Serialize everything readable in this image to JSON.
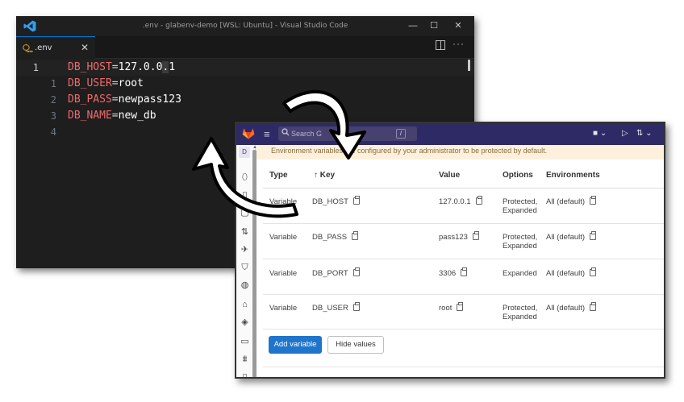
{
  "vscode": {
    "title": ".env - glabenv-demo [WSL: Ubuntu] - Visual Studio Code",
    "window_buttons": [
      "—",
      "☐",
      "✕"
    ],
    "tab": {
      "icon": "⵿",
      "label": ".env",
      "close": "✕"
    },
    "more": "···",
    "lines": [
      {
        "number": "1",
        "key": "DB_HOST",
        "eq": "=",
        "value_a": "127.0.0",
        "value_sel": ".",
        "value_b": "1"
      },
      {
        "number": "1",
        "key": "DB_USER",
        "eq": "=",
        "value": "root"
      },
      {
        "number": "2",
        "key": "DB_PASS",
        "eq": "=",
        "value": "newpass123"
      },
      {
        "number": "3",
        "key": "DB_NAME",
        "eq": "=",
        "value": "new_db"
      },
      {
        "number": "4"
      }
    ]
  },
  "gitlab": {
    "search_placeholder": "Search G",
    "search_shortcut": "/",
    "banner": "Environment variables are configured by your administrator to be protected by default.",
    "sidebar_letter": "D",
    "columns": {
      "type": "Type",
      "key": "↑ Key",
      "value": "Value",
      "options": "Options",
      "environments": "Environments"
    },
    "rows": [
      {
        "type": "Variable",
        "key": "DB_HOST",
        "value": "127.0.0.1",
        "options_1": "Protected,",
        "options_2": "Expanded",
        "environment": "All (default)"
      },
      {
        "type": "Variable",
        "key": "DB_PASS",
        "value": "pass123",
        "options_1": "Protected,",
        "options_2": "Expanded",
        "environment": "All (default)"
      },
      {
        "type": "Variable",
        "key": "DB_PORT",
        "value": "3306",
        "options_1": "Expanded",
        "options_2": "",
        "environment": "All (default)"
      },
      {
        "type": "Variable",
        "key": "DB_USER",
        "value": "root",
        "options_1": "Protected,",
        "options_2": "Expanded",
        "environment": "All (default)"
      }
    ],
    "add_button": "Add variable",
    "hide_button": "Hide values"
  },
  "colors": {
    "vscode_bg": "#1e1e1e",
    "env_key": "#f06a6a",
    "gitlab_header": "#2e2a65",
    "gitlab_primary": "#1f75cb"
  }
}
